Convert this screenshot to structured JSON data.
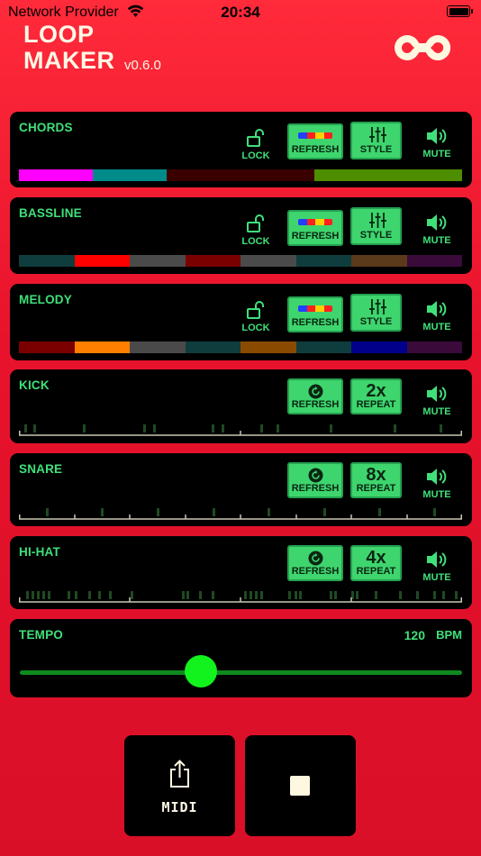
{
  "status": {
    "carrier": "Network Provider",
    "time": "20:34"
  },
  "app": {
    "title_line1": "LOOP",
    "title_line2": "MAKER",
    "version": "v0.6.0"
  },
  "labels": {
    "lock": "LOCK",
    "refresh": "REFRESH",
    "style": "STYLE",
    "mute": "MUTE",
    "repeat": "REPEAT"
  },
  "tracks": [
    {
      "name": "CHORDS",
      "colors": [
        "#ff00ff",
        "#008b8b",
        "#3a0000",
        "#3a0000",
        "#4e8c00",
        "#4e8c00"
      ]
    },
    {
      "name": "BASSLINE",
      "colors": [
        "#0f3d3d",
        "#ff0000",
        "#4a4a4a",
        "#7a0000",
        "#4a4a4a",
        "#0f3d3d",
        "#5a3a1a",
        "#3a0a3a"
      ]
    },
    {
      "name": "MELODY",
      "colors": [
        "#7a0000",
        "#ff8000",
        "#4a4a4a",
        "#0f3d3d",
        "#8a4a00",
        "#0f3d3d",
        "#00008b",
        "#3a0a3a"
      ]
    }
  ],
  "drums": [
    {
      "name": "KICK",
      "repeat": "2x"
    },
    {
      "name": "SNARE",
      "repeat": "8x"
    },
    {
      "name": "HI-HAT",
      "repeat": "4x"
    }
  ],
  "tempo": {
    "label": "TEMPO",
    "value": "120",
    "unit": "BPM",
    "slider_fraction": 0.41
  },
  "footer": {
    "midi_label": "MIDI"
  },
  "colors": {
    "accent_green": "#3fe07a",
    "button_green": "#3ed56e",
    "background_red": "#e8122c"
  },
  "icons": [
    "wifi-icon",
    "battery-icon",
    "infinity-logo-icon",
    "unlock-icon",
    "sliders-icon",
    "speaker-icon",
    "refresh-icon",
    "share-icon",
    "stop-icon"
  ]
}
